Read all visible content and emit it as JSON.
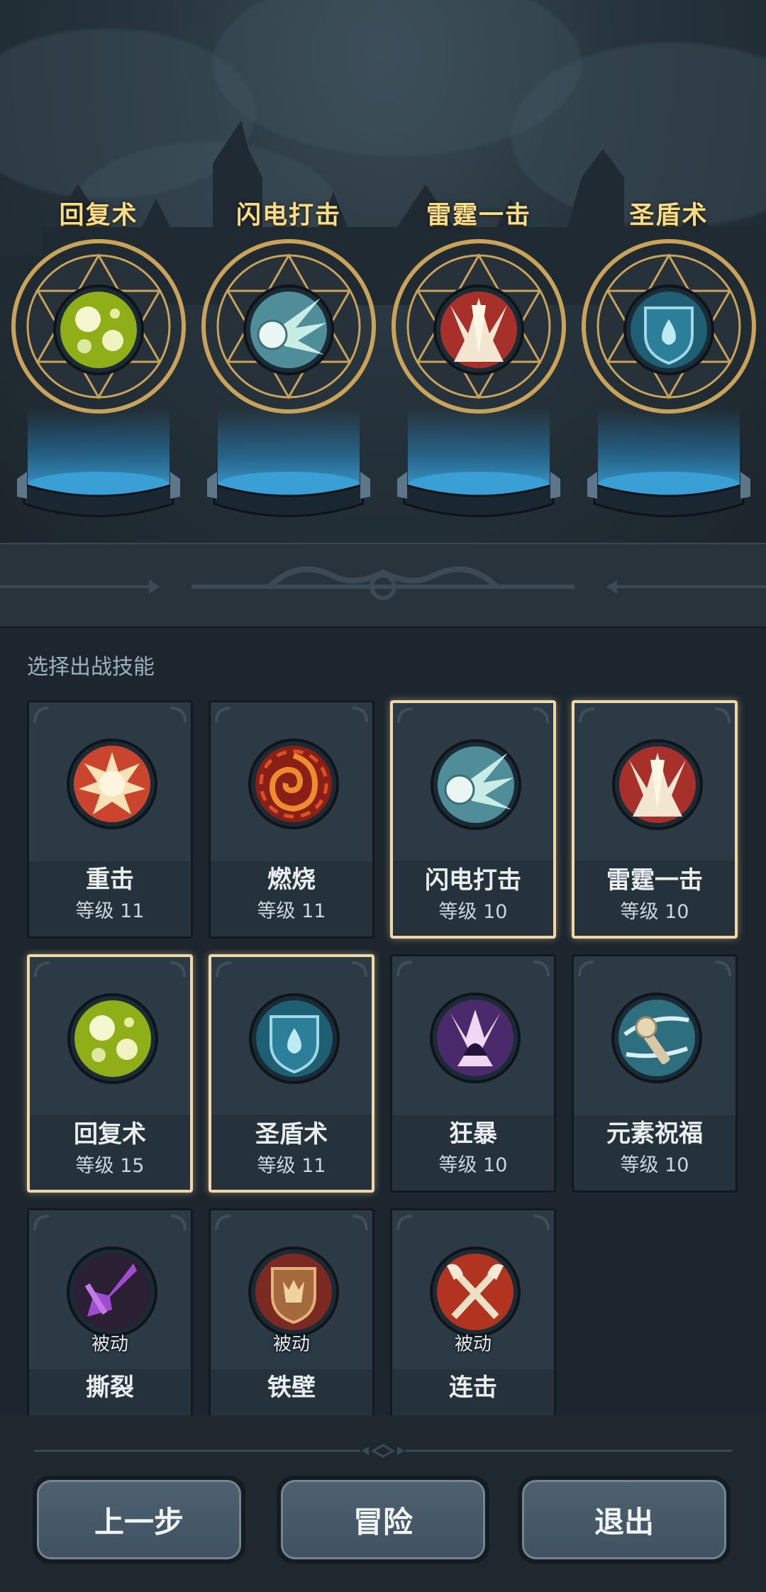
{
  "equipped_slots": [
    {
      "name": "回复术",
      "icon": "heal-icon"
    },
    {
      "name": "闪电打击",
      "icon": "lightning-strike-icon"
    },
    {
      "name": "雷霆一击",
      "icon": "thunder-strike-icon"
    },
    {
      "name": "圣盾术",
      "icon": "holy-shield-icon"
    }
  ],
  "section_label": "选择出战技能",
  "skills": [
    {
      "name": "重击",
      "level": "等级 11",
      "icon": "heavy-strike-icon",
      "selected": false
    },
    {
      "name": "燃烧",
      "level": "等级 11",
      "icon": "burn-icon",
      "selected": false
    },
    {
      "name": "闪电打击",
      "level": "等级 10",
      "icon": "lightning-strike-icon",
      "selected": true
    },
    {
      "name": "雷霆一击",
      "level": "等级 10",
      "icon": "thunder-strike-icon",
      "selected": true
    },
    {
      "name": "回复术",
      "level": "等级 15",
      "icon": "heal-icon",
      "selected": true
    },
    {
      "name": "圣盾术",
      "level": "等级 11",
      "icon": "holy-shield-icon",
      "selected": true
    },
    {
      "name": "狂暴",
      "level": "等级 10",
      "icon": "berserk-icon",
      "selected": false
    },
    {
      "name": "元素祝福",
      "level": "等级 10",
      "icon": "elemental-blessing-icon",
      "selected": false
    },
    {
      "name": "撕裂",
      "tag": "被动",
      "icon": "rend-icon",
      "selected": false
    },
    {
      "name": "铁壁",
      "tag": "被动",
      "icon": "iron-wall-icon",
      "selected": false
    },
    {
      "name": "连击",
      "tag": "被动",
      "icon": "combo-icon",
      "selected": false
    }
  ],
  "buttons": {
    "prev": "上一步",
    "adventure": "冒险",
    "exit": "退出"
  },
  "colors": {
    "selected_border": "#f1d7a6",
    "title_gold": "#f5dd8a",
    "background": "#1d262e"
  }
}
